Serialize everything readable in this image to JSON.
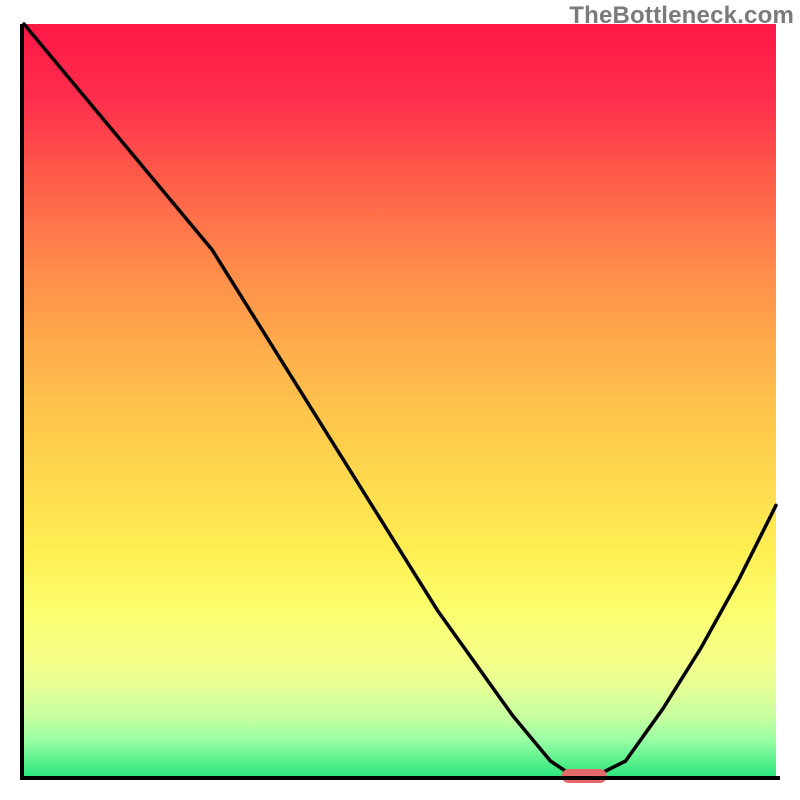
{
  "watermark": "TheBottleneck.com",
  "chart_data": {
    "type": "line",
    "title": "",
    "xlabel": "",
    "ylabel": "",
    "x_range": [
      0,
      100
    ],
    "y_range": [
      0,
      100
    ],
    "grid": false,
    "background_gradient": {
      "direction": "vertical",
      "stops": [
        {
          "pos": 0,
          "color": "#ff1846",
          "meaning": "worst"
        },
        {
          "pos": 50,
          "color": "#ffc04c",
          "meaning": "mid"
        },
        {
          "pos": 80,
          "color": "#fbff6e",
          "meaning": "good"
        },
        {
          "pos": 100,
          "color": "#2ee67e",
          "meaning": "best"
        }
      ]
    },
    "series": [
      {
        "name": "bottleneck-curve",
        "x": [
          0,
          5,
          10,
          15,
          20,
          25,
          30,
          35,
          40,
          45,
          50,
          55,
          60,
          65,
          70,
          73,
          76,
          80,
          85,
          90,
          95,
          100
        ],
        "y": [
          100,
          94,
          88,
          82,
          76,
          70,
          62,
          54,
          46,
          38,
          30,
          22,
          15,
          8,
          2,
          0,
          0,
          2,
          9,
          17,
          26,
          36
        ]
      }
    ],
    "marker": {
      "name": "optimal-point",
      "x": 74.5,
      "y": 0,
      "width_pct": 6,
      "color": "#e26a6a"
    }
  }
}
